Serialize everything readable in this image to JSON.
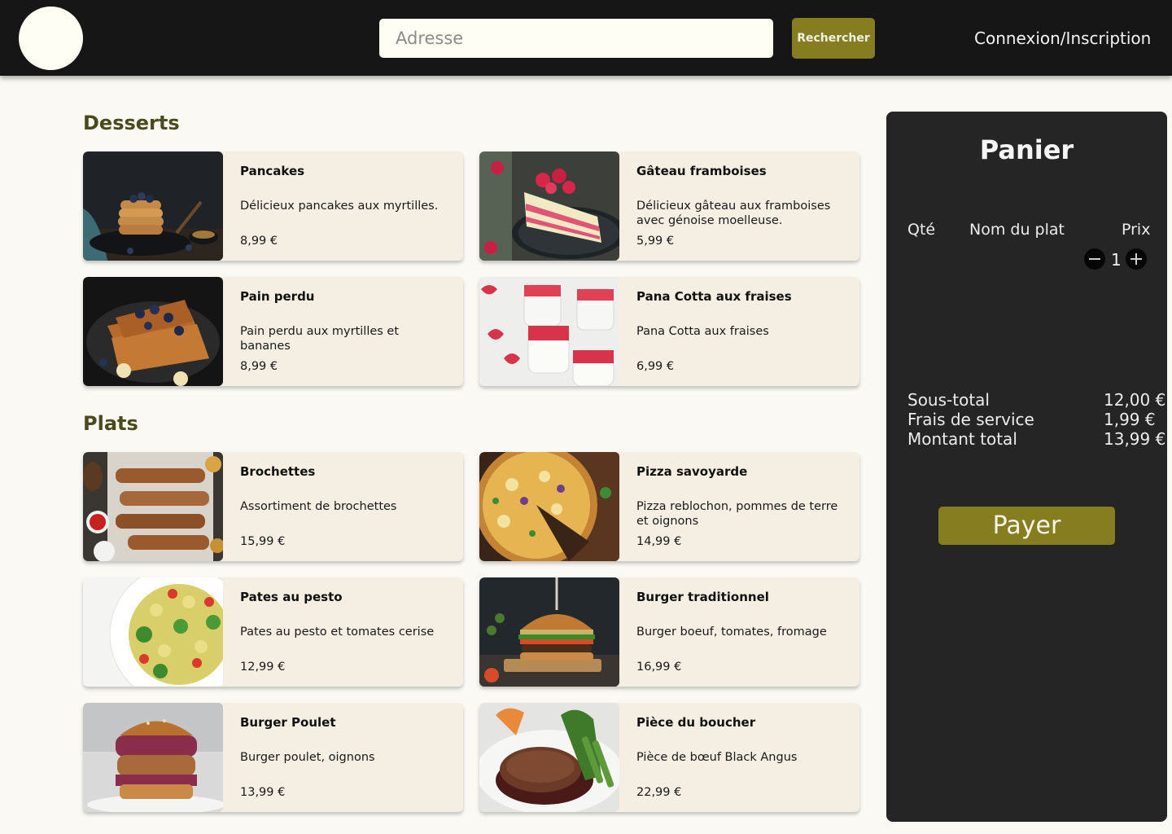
{
  "header": {
    "search_placeholder": "Adresse",
    "search_button": "Rechercher",
    "login_link": "Connexion/Inscription"
  },
  "sections": [
    {
      "title": "Desserts",
      "items": [
        {
          "name": "Pancakes",
          "description": "Délicieux pancakes aux myrtilles.",
          "price": "8,99 €",
          "image": "pancakes-photo"
        },
        {
          "name": "Gâteau framboises",
          "description": "Délicieux gâteau aux framboises avec génoise moelleuse.",
          "price": "5,99 €",
          "image": "raspberry-cake-photo"
        },
        {
          "name": "Pain perdu",
          "description": "Pain perdu aux myrtilles et bananes",
          "price": "8,99 €",
          "image": "french-toast-photo"
        },
        {
          "name": "Pana Cotta aux fraises",
          "description": "Pana Cotta aux fraises",
          "price": "6,99 €",
          "image": "panna-cotta-photo"
        }
      ]
    },
    {
      "title": "Plats",
      "items": [
        {
          "name": "Brochettes",
          "description": "Assortiment de brochettes",
          "price": "15,99 €",
          "image": "skewers-photo"
        },
        {
          "name": "Pizza savoyarde",
          "description": "Pizza reblochon, pommes de terre et oignons",
          "price": "14,99 €",
          "image": "pizza-photo"
        },
        {
          "name": "Pates au pesto",
          "description": "Pates au pesto et tomates cerise",
          "price": "12,99 €",
          "image": "pesto-pasta-photo"
        },
        {
          "name": "Burger traditionnel",
          "description": "Burger boeuf, tomates, fromage",
          "price": "16,99 €",
          "image": "beef-burger-photo"
        },
        {
          "name": "Burger Poulet",
          "description": "Burger poulet, oignons",
          "price": "13,99 €",
          "image": "chicken-burger-photo"
        },
        {
          "name": "Pièce du boucher",
          "description": "Pièce de bœuf Black Angus",
          "price": "22,99 €",
          "image": "steak-photo"
        }
      ]
    }
  ],
  "cart": {
    "title": "Panier",
    "columns": {
      "qty": "Qté",
      "name": "Nom du plat",
      "price": "Prix"
    },
    "quantity": "1",
    "subtotal_label": "Sous-total",
    "subtotal_value": "12,00 €",
    "service_label": "Frais de service",
    "service_value": "1,99 €",
    "total_label": "Montant total",
    "total_value": "13,99 €",
    "pay_button": "Payer"
  },
  "colors": {
    "accent": "#857d20",
    "header_bg": "#161616",
    "card_bg": "#f4eee3",
    "cart_bg": "#252525",
    "section_title": "#4a4a1c"
  }
}
